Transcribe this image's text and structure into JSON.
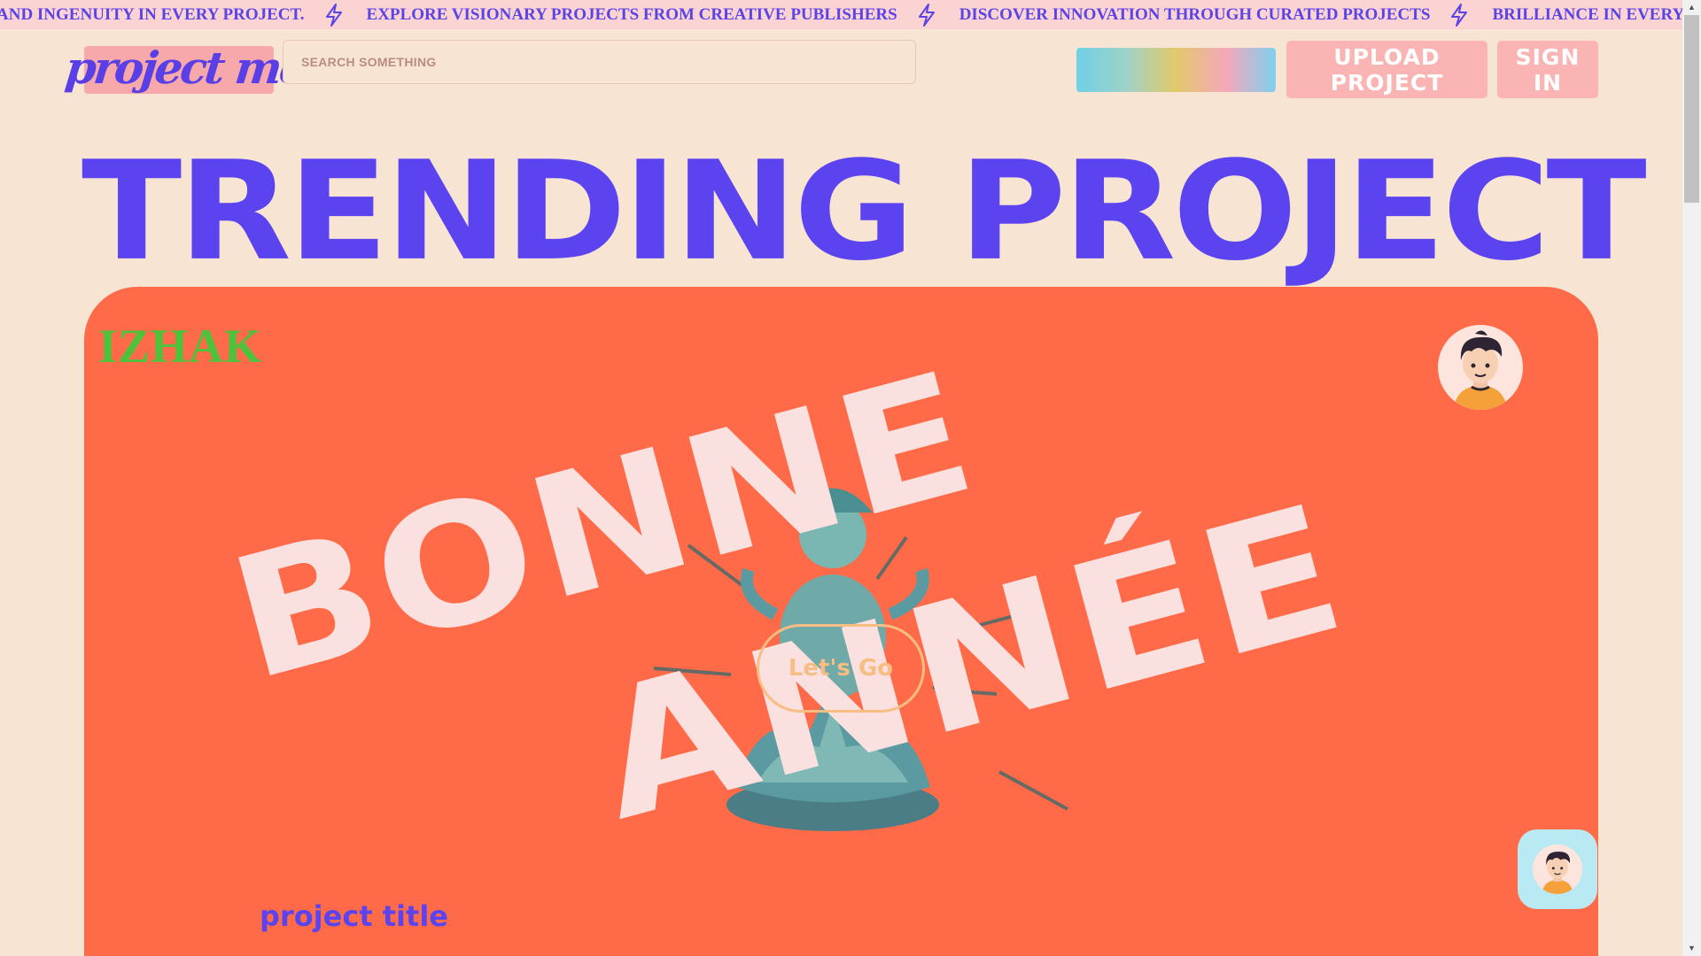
{
  "marquee": {
    "items": [
      "AND INGENUITY IN EVERY PROJECT.",
      "EXPLORE VISIONARY PROJECTS FROM CREATIVE PUBLISHERS",
      "DISCOVER INNOVATION THROUGH CURATED PROJECTS",
      "BRILLIANCE IN EVERY PROJECT, CRAFTED WITH PASSION"
    ],
    "separator_icon": "lightning-bolt-icon"
  },
  "header": {
    "logo": "project media",
    "search_placeholder": "SEARCH SOMETHING",
    "upload_label": "UPLOAD PROJECT",
    "signin_label": "SIGN IN"
  },
  "page_title": "TRENDING PROJECT",
  "card": {
    "author": "IZHAK",
    "artwork_words": [
      "BONNE",
      "ANNÉE"
    ],
    "cta_label": "Let's Go",
    "project_title": "project title",
    "background_color": "#ff6b49"
  },
  "colors": {
    "accent": "#5b44f0",
    "page_background": "#f8e4d2",
    "pink_button": "#fbb4b4",
    "author_green": "#4ec23a"
  },
  "icons": {
    "avatar": "avatar-icon",
    "chat": "chat-avatar-icon"
  }
}
